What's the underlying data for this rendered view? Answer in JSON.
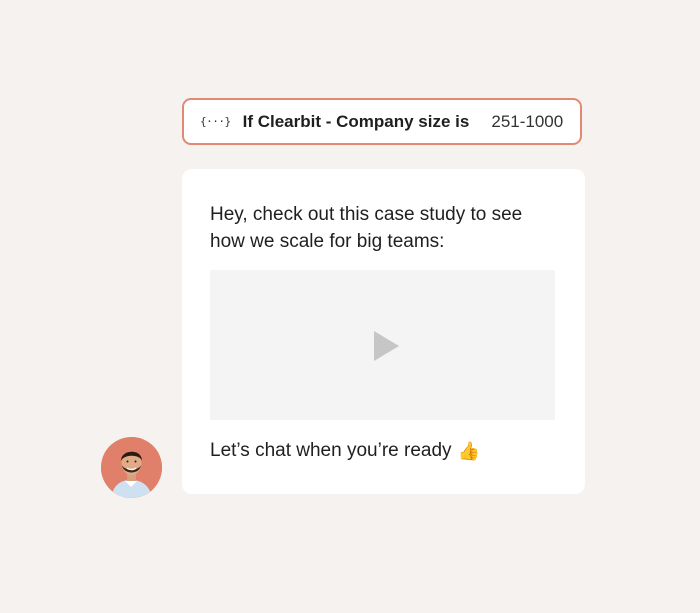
{
  "condition": {
    "icon": "variable-braces-icon",
    "icon_text": "{···}",
    "rule": "If Clearbit - Company size is",
    "value": "251-1000"
  },
  "message": {
    "intro": "Hey, check out this case study to see how we scale for big teams:",
    "video_icon": "play-icon",
    "outro": "Let’s chat when you’re ready",
    "emoji": "👍"
  },
  "sender": {
    "avatar_icon": "avatar"
  },
  "colors": {
    "background": "#f6f2ef",
    "condition_border": "#e18a73",
    "avatar_bg": "#e1806a"
  }
}
